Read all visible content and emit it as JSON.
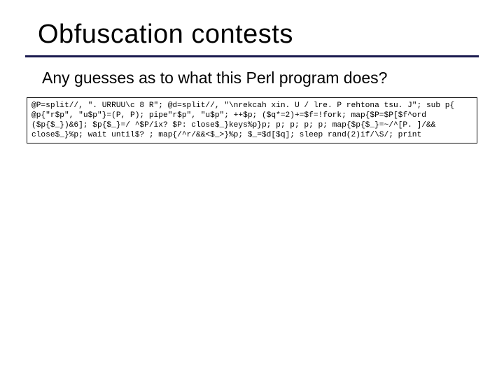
{
  "slide": {
    "title": "Obfuscation contests",
    "subtitle": "Any guesses as to what this Perl program does?",
    "code_line1": "@P=split//, \". URRUU\\c 8 R\"; @d=split//, \"\\nrekcah xin. U / lre. P rehtona tsu. J\"; sub p{",
    "code_line2": "@p{\"r$p\", \"u$p\"}=(P, P); pipe\"r$p\", \"u$p\"; ++$p; ($q*=2)+=$f=!fork; map{$P=$P[$f^ord",
    "code_line3": "($p{$_})&6]; $p{$_}=/ ^$P/ix? $P: close$_}keys%p}p; p; p; p; p; map{$p{$_}=~/^[P. ]/&&",
    "code_line4": "close$_}%p; wait until$? ; map{/^r/&&<$_>}%p; $_=$d[$q]; sleep rand(2)if/\\S/; print"
  }
}
